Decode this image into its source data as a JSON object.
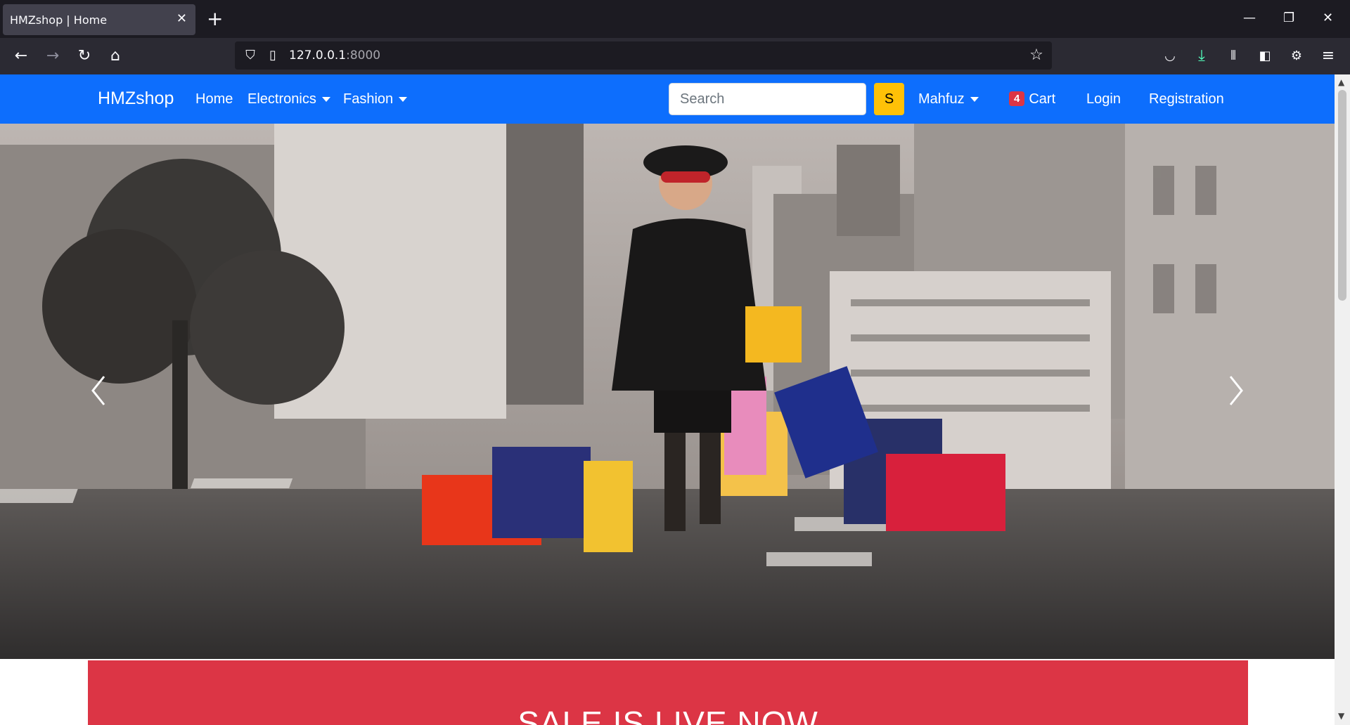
{
  "browser": {
    "tab_title": "HMZshop | Home",
    "url_host": "127.0.0.1",
    "url_port": ":8000"
  },
  "site": {
    "brand": "HMZshop",
    "nav": {
      "home": "Home",
      "electronics": "Electronics",
      "fashion": "Fashion",
      "user": "Mahfuz",
      "cart_count": "4",
      "cart": "Cart",
      "login": "Login",
      "registration": "Registration"
    },
    "search": {
      "placeholder": "Search",
      "button": "S"
    }
  },
  "sale_banner": {
    "text": "SALE IS LIVE NOW"
  },
  "colors": {
    "navbar": "#0d6efd",
    "search_button": "#ffc107",
    "badge": "#dc3545",
    "sale_banner": "#dc3545"
  }
}
